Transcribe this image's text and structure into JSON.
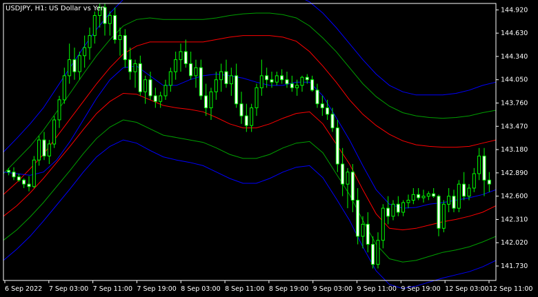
{
  "title": "USDJPY, H1:  US Dollar vs Yen",
  "colors": {
    "background": "#000000",
    "axis": "#ffffff",
    "candle_bull_body": "#000000",
    "candle_bear_body": "#ffffff",
    "candle_outline": "#00ff00",
    "band_outer": "#0000ff",
    "band_middle": "#00a000",
    "band_inner": "#ff0000",
    "midline": "#0000ff"
  },
  "chart_data": {
    "type": "candlestick",
    "symbol": "USDJPY",
    "timeframe": "H1",
    "y_axis_labels": [
      "144.920",
      "144.630",
      "144.340",
      "144.050",
      "143.760",
      "143.470",
      "143.180",
      "142.890",
      "142.600",
      "142.310",
      "142.020",
      "141.730"
    ],
    "ylim": [
      141.55,
      145.0
    ],
    "x_axis_labels": [
      "6 Sep 2022",
      "7 Sep 03:00",
      "7 Sep 11:00",
      "7 Sep 19:00",
      "8 Sep 03:00",
      "8 Sep 11:00",
      "8 Sep 19:00",
      "9 Sep 03:00",
      "9 Sep 11:00",
      "9 Sep 19:00",
      "12 Sep 03:00",
      "12 Sep 11:00"
    ],
    "series": [
      {
        "role": "upper band outer",
        "color": "#0000ff",
        "values": [
          143.15,
          143.32,
          143.5,
          143.7,
          143.95,
          144.2,
          144.45,
          144.68,
          144.88,
          145.05,
          145.1,
          145.1,
          145.05,
          145.05,
          145.06,
          145.08,
          145.1,
          145.12,
          145.12,
          145.13,
          145.15,
          145.13,
          145.1,
          145.02,
          144.88,
          144.7,
          144.5,
          144.3,
          144.12,
          143.98,
          143.9,
          143.86,
          143.86,
          143.86,
          143.88,
          143.92,
          143.98,
          144.02
        ]
      },
      {
        "role": "upper band middle",
        "color": "#00a000",
        "values": [
          142.88,
          143.05,
          143.22,
          143.42,
          143.65,
          143.88,
          144.12,
          144.35,
          144.55,
          144.72,
          144.8,
          144.82,
          144.8,
          144.8,
          144.8,
          144.8,
          144.82,
          144.85,
          144.87,
          144.88,
          144.88,
          144.86,
          144.82,
          144.72,
          144.57,
          144.4,
          144.2,
          144.0,
          143.84,
          143.72,
          143.64,
          143.6,
          143.58,
          143.57,
          143.58,
          143.6,
          143.64,
          143.67
        ]
      },
      {
        "role": "upper band inner",
        "color": "#ff0000",
        "values": [
          142.62,
          142.77,
          142.94,
          143.12,
          143.34,
          143.56,
          143.78,
          144.0,
          144.2,
          144.37,
          144.47,
          144.52,
          144.52,
          144.52,
          144.52,
          144.52,
          144.55,
          144.58,
          144.6,
          144.6,
          144.6,
          144.58,
          144.53,
          144.4,
          144.22,
          144.02,
          143.8,
          143.62,
          143.48,
          143.37,
          143.29,
          143.24,
          143.22,
          143.21,
          143.21,
          143.22,
          143.26,
          143.3
        ]
      },
      {
        "role": "midline",
        "color": "#0000ff",
        "values": [
          142.9,
          142.88,
          142.86,
          142.9,
          143.05,
          143.28,
          143.55,
          143.82,
          144.05,
          144.2,
          144.22,
          144.1,
          143.98,
          143.98,
          144.05,
          144.1,
          144.12,
          144.1,
          144.07,
          144.02,
          143.98,
          143.98,
          144.02,
          144.02,
          143.85,
          143.58,
          143.3,
          142.98,
          142.68,
          142.5,
          142.45,
          142.46,
          142.5,
          142.52,
          142.55,
          142.58,
          142.62,
          142.68
        ]
      },
      {
        "role": "lower band inner",
        "color": "#ff0000",
        "values": [
          142.35,
          142.48,
          142.64,
          142.82,
          143.02,
          143.22,
          143.43,
          143.63,
          143.78,
          143.88,
          143.87,
          143.8,
          143.73,
          143.7,
          143.68,
          143.65,
          143.58,
          143.5,
          143.45,
          143.45,
          143.5,
          143.57,
          143.63,
          143.65,
          143.5,
          143.25,
          143.0,
          142.68,
          142.38,
          142.2,
          142.18,
          142.2,
          142.24,
          142.28,
          142.31,
          142.35,
          142.4,
          142.48
        ]
      },
      {
        "role": "lower band middle",
        "color": "#00a000",
        "values": [
          142.05,
          142.18,
          142.34,
          142.52,
          142.72,
          142.92,
          143.13,
          143.32,
          143.46,
          143.55,
          143.52,
          143.44,
          143.36,
          143.33,
          143.3,
          143.27,
          143.2,
          143.12,
          143.07,
          143.07,
          143.12,
          143.2,
          143.26,
          143.28,
          143.14,
          142.88,
          142.62,
          142.3,
          142.0,
          141.82,
          141.78,
          141.8,
          141.85,
          141.9,
          141.93,
          141.97,
          142.03,
          142.1
        ]
      },
      {
        "role": "lower band outer",
        "color": "#0000ff",
        "values": [
          141.8,
          141.94,
          142.1,
          142.29,
          142.49,
          142.69,
          142.9,
          143.09,
          143.22,
          143.3,
          143.26,
          143.17,
          143.09,
          143.05,
          143.02,
          142.98,
          142.9,
          142.82,
          142.76,
          142.76,
          142.82,
          142.9,
          142.96,
          142.98,
          142.83,
          142.57,
          142.3,
          141.97,
          141.67,
          141.5,
          141.45,
          141.48,
          141.53,
          141.58,
          141.62,
          141.66,
          141.72,
          141.8
        ]
      }
    ],
    "candles": [
      [
        142.92,
        142.95,
        142.86,
        142.9
      ],
      [
        142.9,
        142.96,
        142.8,
        142.84
      ],
      [
        142.84,
        142.88,
        142.78,
        142.8
      ],
      [
        142.8,
        142.82,
        142.7,
        142.75
      ],
      [
        142.75,
        142.85,
        142.66,
        142.72
      ],
      [
        142.72,
        143.1,
        142.7,
        143.05
      ],
      [
        143.05,
        143.35,
        142.98,
        143.3
      ],
      [
        143.3,
        143.4,
        143.05,
        143.1
      ],
      [
        143.1,
        143.3,
        143.0,
        143.25
      ],
      [
        143.25,
        143.6,
        143.2,
        143.55
      ],
      [
        143.55,
        143.85,
        143.45,
        143.8
      ],
      [
        143.8,
        144.2,
        143.75,
        144.1
      ],
      [
        144.1,
        144.5,
        144.0,
        144.3
      ],
      [
        144.3,
        144.45,
        144.05,
        144.15
      ],
      [
        144.15,
        144.4,
        144.05,
        144.35
      ],
      [
        144.35,
        144.6,
        144.2,
        144.45
      ],
      [
        144.45,
        144.7,
        144.3,
        144.6
      ],
      [
        144.6,
        144.9,
        144.5,
        144.85
      ],
      [
        144.85,
        145.0,
        144.7,
        144.95
      ],
      [
        144.95,
        145.0,
        144.6,
        144.75
      ],
      [
        144.75,
        144.9,
        144.6,
        144.85
      ],
      [
        144.85,
        144.95,
        144.5,
        144.55
      ],
      [
        144.55,
        144.7,
        144.35,
        144.6
      ],
      [
        144.6,
        144.68,
        144.2,
        144.3
      ],
      [
        144.3,
        144.45,
        144.05,
        144.15
      ],
      [
        144.15,
        144.3,
        143.95,
        144.25
      ],
      [
        144.25,
        144.35,
        143.85,
        143.9
      ],
      [
        143.9,
        144.1,
        143.75,
        144.05
      ],
      [
        144.05,
        144.15,
        143.8,
        143.85
      ],
      [
        143.85,
        143.95,
        143.7,
        143.78
      ],
      [
        143.78,
        143.9,
        143.7,
        143.85
      ],
      [
        143.85,
        144.05,
        143.8,
        143.98
      ],
      [
        143.98,
        144.2,
        143.9,
        144.15
      ],
      [
        144.15,
        144.4,
        144.05,
        144.3
      ],
      [
        144.3,
        144.5,
        144.15,
        144.4
      ],
      [
        144.4,
        144.55,
        144.2,
        144.25
      ],
      [
        144.25,
        144.4,
        144.05,
        144.1
      ],
      [
        144.1,
        144.3,
        143.95,
        144.2
      ],
      [
        144.2,
        144.3,
        143.8,
        143.85
      ],
      [
        143.85,
        144.0,
        143.6,
        143.7
      ],
      [
        143.7,
        143.95,
        143.55,
        143.9
      ],
      [
        143.9,
        144.15,
        143.8,
        144.05
      ],
      [
        144.05,
        144.25,
        143.9,
        144.15
      ],
      [
        144.15,
        144.3,
        143.95,
        144.0
      ],
      [
        144.0,
        144.2,
        143.85,
        144.1
      ],
      [
        144.1,
        144.25,
        143.7,
        143.75
      ],
      [
        143.75,
        143.9,
        143.5,
        143.6
      ],
      [
        143.6,
        143.75,
        143.4,
        143.48
      ],
      [
        143.48,
        143.75,
        143.4,
        143.7
      ],
      [
        143.7,
        144.0,
        143.6,
        143.95
      ],
      [
        143.95,
        144.3,
        143.85,
        144.1
      ],
      [
        144.1,
        144.2,
        143.95,
        144.05
      ],
      [
        144.05,
        144.15,
        143.95,
        144.02
      ],
      [
        144.02,
        144.15,
        143.98,
        144.1
      ],
      [
        144.1,
        144.18,
        144.0,
        144.05
      ],
      [
        144.05,
        144.15,
        143.95,
        144.0
      ],
      [
        144.0,
        144.1,
        143.9,
        143.95
      ],
      [
        143.95,
        144.05,
        143.85,
        143.98
      ],
      [
        143.98,
        144.1,
        143.9,
        144.08
      ],
      [
        144.08,
        144.12,
        144.0,
        144.05
      ],
      [
        144.05,
        144.1,
        143.9,
        143.92
      ],
      [
        143.92,
        144.0,
        143.7,
        143.75
      ],
      [
        143.75,
        143.85,
        143.6,
        143.7
      ],
      [
        143.7,
        143.8,
        143.55,
        143.62
      ],
      [
        143.62,
        143.7,
        143.4,
        143.45
      ],
      [
        143.45,
        143.55,
        142.9,
        143.0
      ],
      [
        143.0,
        143.2,
        142.6,
        142.75
      ],
      [
        142.75,
        142.95,
        142.45,
        142.9
      ],
      [
        142.9,
        143.0,
        142.4,
        142.55
      ],
      [
        142.55,
        142.7,
        142.0,
        142.1
      ],
      [
        142.1,
        142.35,
        141.95,
        142.25
      ],
      [
        142.25,
        142.4,
        141.9,
        142.0
      ],
      [
        142.0,
        142.1,
        141.7,
        141.75
      ],
      [
        141.75,
        142.15,
        141.7,
        142.05
      ],
      [
        142.05,
        142.5,
        141.95,
        142.45
      ],
      [
        142.45,
        142.6,
        142.25,
        142.35
      ],
      [
        142.35,
        142.55,
        142.3,
        142.5
      ],
      [
        142.5,
        142.6,
        142.35,
        142.4
      ],
      [
        142.4,
        142.55,
        142.35,
        142.52
      ],
      [
        142.52,
        142.62,
        142.45,
        142.55
      ],
      [
        142.55,
        142.7,
        142.5,
        142.62
      ],
      [
        142.62,
        142.7,
        142.55,
        142.58
      ],
      [
        142.58,
        142.68,
        142.52,
        142.6
      ],
      [
        142.6,
        142.66,
        142.55,
        142.63
      ],
      [
        142.63,
        142.7,
        142.58,
        142.6
      ],
      [
        142.6,
        142.62,
        142.1,
        142.2
      ],
      [
        142.2,
        142.55,
        142.15,
        142.5
      ],
      [
        142.5,
        142.7,
        142.4,
        142.6
      ],
      [
        142.6,
        142.68,
        142.4,
        142.45
      ],
      [
        142.45,
        142.8,
        142.4,
        142.75
      ],
      [
        142.75,
        142.9,
        142.55,
        142.6
      ],
      [
        142.6,
        142.75,
        142.55,
        142.7
      ],
      [
        142.7,
        142.95,
        142.65,
        142.88
      ],
      [
        142.88,
        143.2,
        142.8,
        143.1
      ],
      [
        143.1,
        143.2,
        142.6,
        142.8
      ],
      [
        142.8,
        142.9,
        142.65,
        142.75
      ]
    ]
  }
}
